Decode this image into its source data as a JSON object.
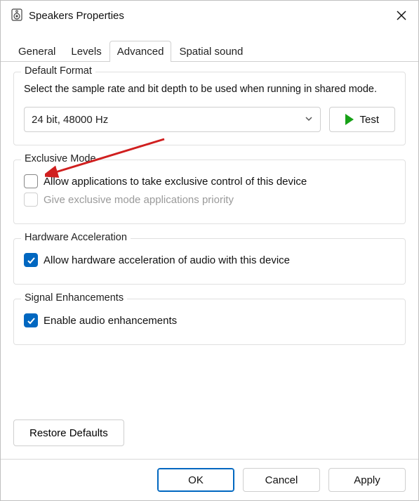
{
  "window": {
    "title": "Speakers Properties"
  },
  "tabs": {
    "general": "General",
    "levels": "Levels",
    "advanced": "Advanced",
    "spatial": "Spatial sound"
  },
  "defaultFormat": {
    "group": "Default Format",
    "hint": "Select the sample rate and bit depth to be used when running in shared mode.",
    "selected": "24 bit, 48000 Hz",
    "testLabel": "Test"
  },
  "exclusive": {
    "group": "Exclusive Mode",
    "allow": "Allow applications to take exclusive control of this device",
    "priority": "Give exclusive mode applications priority"
  },
  "hardware": {
    "group": "Hardware Acceleration",
    "allow": "Allow hardware acceleration of audio with this device"
  },
  "signal": {
    "group": "Signal Enhancements",
    "enable": "Enable audio enhancements"
  },
  "restore": "Restore Defaults",
  "footer": {
    "ok": "OK",
    "cancel": "Cancel",
    "apply": "Apply"
  }
}
